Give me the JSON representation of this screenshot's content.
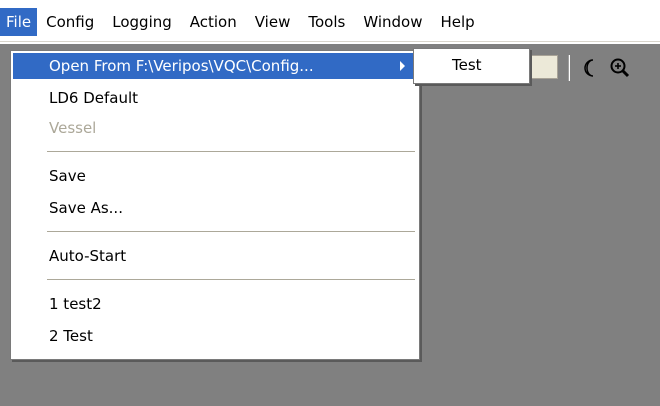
{
  "menubar": {
    "items": [
      "File",
      "Config",
      "Logging",
      "Action",
      "View",
      "Tools",
      "Window",
      "Help"
    ],
    "active": "File"
  },
  "file_menu": {
    "items": [
      {
        "label": "Open From F:\\Veripos\\VQC\\Config...",
        "state": "highlighted",
        "has_submenu": true
      },
      {
        "label": "LD6 Default",
        "state": "normal"
      },
      {
        "label": "Vessel",
        "state": "disabled"
      },
      {
        "label": "Save",
        "state": "normal"
      },
      {
        "label": "Save As...",
        "state": "normal"
      },
      {
        "label": "Auto-Start",
        "state": "normal"
      },
      {
        "label": "1 test2",
        "state": "normal"
      },
      {
        "label": "2 Test",
        "state": "normal"
      }
    ]
  },
  "submenu": {
    "items": [
      "Test"
    ]
  },
  "toolbar": {
    "icons": [
      "moon-icon",
      "zoom-in-icon"
    ]
  },
  "colors": {
    "highlight": "#316ac5",
    "workspace": "#808080",
    "disabled_text": "#aca899"
  }
}
